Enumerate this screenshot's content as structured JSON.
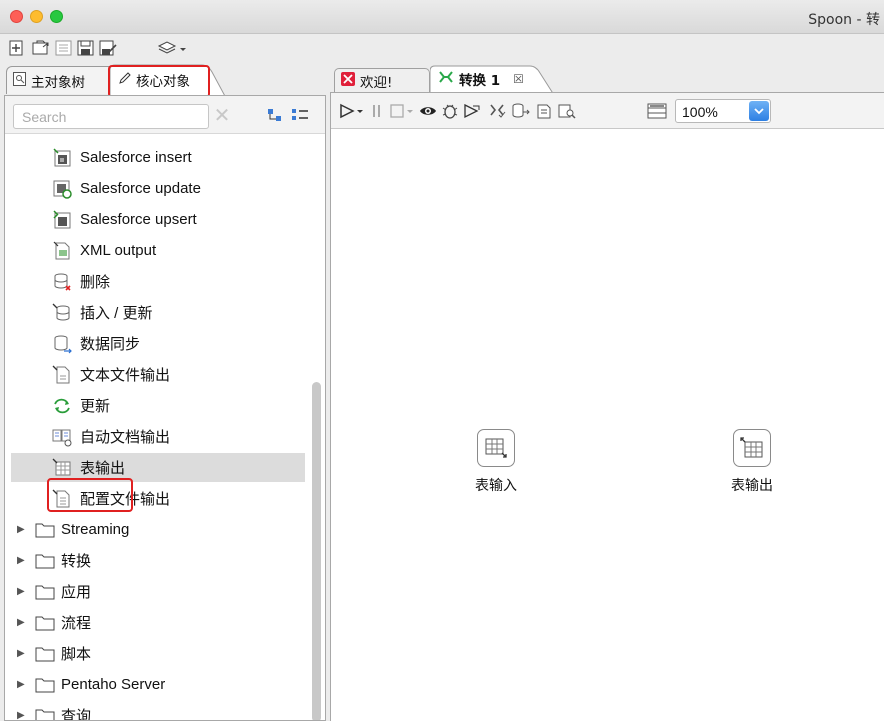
{
  "window": {
    "title": "Spoon - 转"
  },
  "left_panel": {
    "tabs": [
      {
        "label": "主对象树",
        "icon": "object-tree-icon"
      },
      {
        "label": "核心对象",
        "icon": "pencil-icon"
      }
    ],
    "search": {
      "placeholder": "Search"
    },
    "items": [
      {
        "label": "Salesforce insert",
        "icon": "salesforce-insert-icon"
      },
      {
        "label": "Salesforce update",
        "icon": "salesforce-update-icon"
      },
      {
        "label": "Salesforce upsert",
        "icon": "salesforce-upsert-icon"
      },
      {
        "label": "XML output",
        "icon": "xml-output-icon"
      },
      {
        "label": "删除",
        "icon": "delete-icon"
      },
      {
        "label": "插入 / 更新",
        "icon": "insert-update-icon"
      },
      {
        "label": "数据同步",
        "icon": "sync-icon"
      },
      {
        "label": "文本文件输出",
        "icon": "text-file-output-icon"
      },
      {
        "label": "更新",
        "icon": "update-icon"
      },
      {
        "label": "自动文档输出",
        "icon": "auto-doc-icon"
      },
      {
        "label": "表输出",
        "icon": "table-output-icon",
        "selected": true
      },
      {
        "label": "配置文件输出",
        "icon": "config-file-icon"
      }
    ],
    "folders": [
      {
        "label": "Streaming"
      },
      {
        "label": "转换"
      },
      {
        "label": "应用"
      },
      {
        "label": "流程"
      },
      {
        "label": "脚本"
      },
      {
        "label": "Pentaho Server"
      },
      {
        "label": "查询"
      }
    ]
  },
  "right_panel": {
    "tabs": [
      {
        "label": "欢迎!",
        "icon": "welcome-icon"
      },
      {
        "label": "转换 1",
        "icon": "transformation-icon",
        "close": "☒"
      }
    ],
    "zoom": "100%",
    "steps": [
      {
        "label": "表输入",
        "icon": "table-input-icon"
      },
      {
        "label": "表输出",
        "icon": "table-output-icon"
      }
    ]
  },
  "colors": {
    "highlight": "#e02020",
    "selection": "#dcdcdc"
  }
}
